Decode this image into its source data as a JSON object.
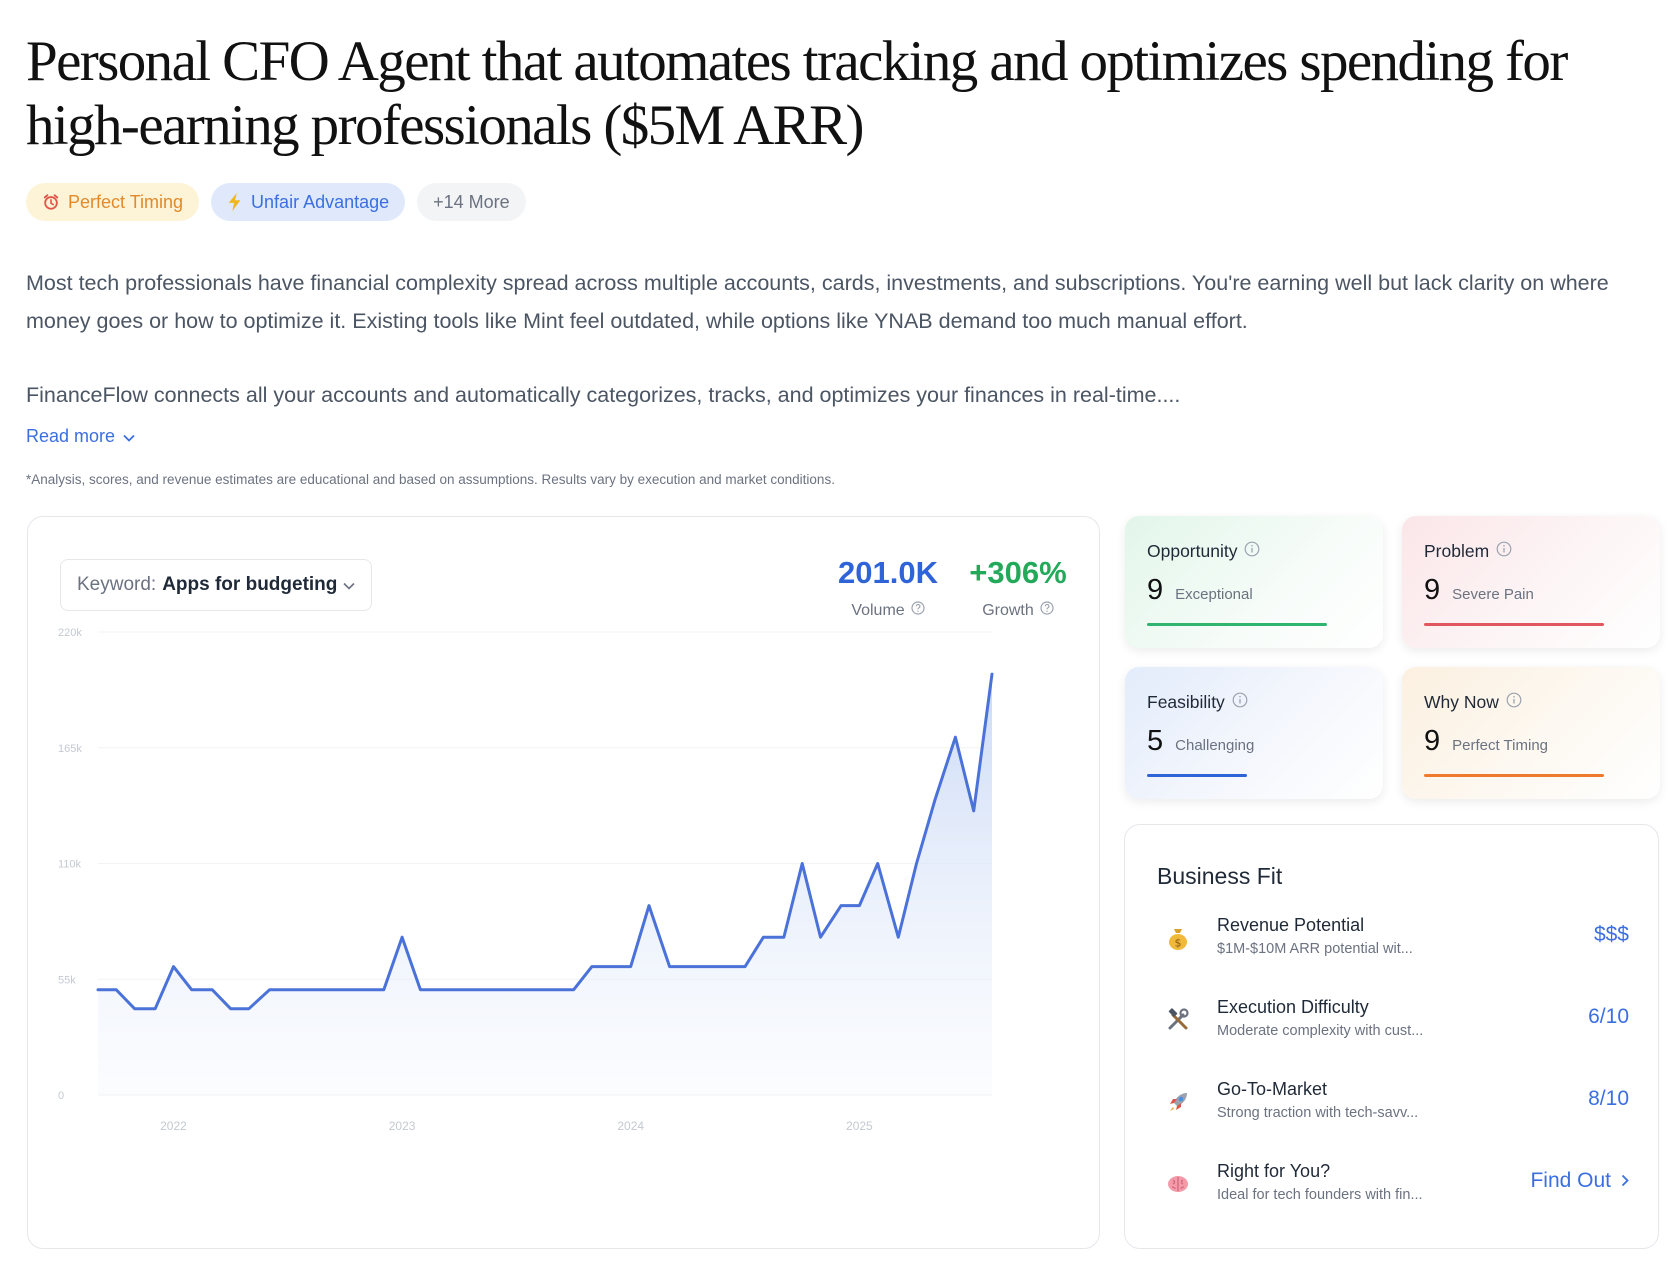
{
  "title": "Personal CFO Agent that automates tracking and optimizes spending for high-earning professionals ($5M ARR)",
  "tags": [
    {
      "label": "Perfect Timing",
      "icon": "alarm-clock-icon",
      "color": "#e28a2b"
    },
    {
      "label": "Unfair Advantage",
      "icon": "lightning-bolt-icon",
      "color": "#3b6fe0"
    },
    {
      "label": "+14 More"
    }
  ],
  "description": {
    "paragraph1": "Most tech professionals have financial complexity spread across multiple accounts, cards, investments, and subscriptions. You're earning well but lack clarity on where money goes or how to optimize it. Existing tools like Mint feel outdated, while options like YNAB demand too much manual effort.",
    "paragraph2": "FinanceFlow connects all your accounts and automatically categorizes, tracks, and optimizes your finances in real-time....",
    "read_more": "Read more",
    "disclaimer": "*Analysis, scores, and revenue estimates are educational and based on assumptions. Results vary by execution and market conditions."
  },
  "trend": {
    "keyword_label": "Keyword:",
    "keyword_value": "Apps for budgeting",
    "volume_value": "201.0K",
    "volume_label": "Volume",
    "growth_value": "+306%",
    "growth_label": "Growth"
  },
  "chart_data": {
    "type": "area",
    "title": "",
    "xlabel": "",
    "ylabel": "",
    "y_ticks": [
      "0",
      "55k",
      "110k",
      "165k",
      "220k"
    ],
    "ylim": [
      0,
      220000
    ],
    "x_ticks": [
      "2022",
      "2023",
      "2024",
      "2025"
    ],
    "x_tick_positions": [
      2022,
      2023,
      2024,
      2025
    ],
    "xlim": [
      2021.67,
      2025.58
    ],
    "line_color": "#4a72d9",
    "series": [
      {
        "x": [
          2021.67,
          2021.75,
          2021.83,
          2021.92,
          2022.0,
          2022.08,
          2022.17,
          2022.25,
          2022.33,
          2022.42,
          2022.5,
          2022.58,
          2022.67,
          2022.75,
          2022.83,
          2022.92,
          2023.0,
          2023.08,
          2023.17,
          2023.25,
          2023.33,
          2023.42,
          2023.5,
          2023.58,
          2023.67,
          2023.75,
          2023.83,
          2023.92,
          2024.0,
          2024.08,
          2024.17,
          2024.25,
          2024.33,
          2024.42,
          2024.5,
          2024.58,
          2024.67,
          2024.75,
          2024.83,
          2024.92,
          2025.0,
          2025.08,
          2025.17,
          2025.25,
          2025.33,
          2025.42,
          2025.5,
          2025.58
        ],
        "values": [
          50000,
          50000,
          41000,
          41000,
          61000,
          50000,
          50000,
          41000,
          41000,
          50000,
          50000,
          50000,
          50000,
          50000,
          50000,
          50000,
          75000,
          50000,
          50000,
          50000,
          50000,
          50000,
          50000,
          50000,
          50000,
          50000,
          61000,
          61000,
          61000,
          90000,
          61000,
          61000,
          61000,
          61000,
          61000,
          75000,
          75000,
          110000,
          75000,
          90000,
          90000,
          110000,
          75000,
          110000,
          140000,
          170000,
          135000,
          200000
        ]
      }
    ]
  },
  "scores": [
    {
      "title": "Opportunity",
      "score": "9",
      "desc": "Exceptional",
      "color": "#2fb56f",
      "level": 0.9
    },
    {
      "title": "Problem",
      "score": "9",
      "desc": "Severe Pain",
      "color": "#e0575f",
      "level": 0.9
    },
    {
      "title": "Feasibility",
      "score": "5",
      "desc": "Challenging",
      "color": "#2f63d8",
      "level": 0.5
    },
    {
      "title": "Why Now",
      "score": "9",
      "desc": "Perfect Timing",
      "color": "#ee7a2e",
      "level": 0.9
    }
  ],
  "business_fit": {
    "title": "Business Fit",
    "items": [
      {
        "icon": "money-bag-icon",
        "label": "Revenue Potential",
        "sub": "$1M-$10M ARR potential wit...",
        "value": "$$$"
      },
      {
        "icon": "hammer-wrench-icon",
        "label": "Execution Difficulty",
        "sub": "Moderate complexity with cust...",
        "value": "6/10"
      },
      {
        "icon": "rocket-icon",
        "label": "Go-To-Market",
        "sub": "Strong traction with tech-savv...",
        "value": "8/10"
      },
      {
        "icon": "brain-icon",
        "label": "Right for You?",
        "sub": "Ideal for tech founders with fin...",
        "value": "Find Out"
      }
    ]
  }
}
